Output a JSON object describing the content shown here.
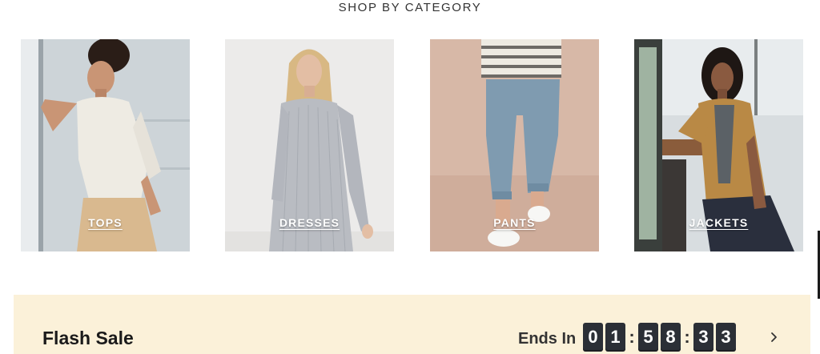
{
  "section": {
    "title": "SHOP BY CATEGORY"
  },
  "categories": [
    {
      "label": "TOPS",
      "image": "woman-in-white-linen-shirt"
    },
    {
      "label": "DRESSES",
      "image": "woman-in-striped-shirt-dress"
    },
    {
      "label": "PANTS",
      "image": "blue-cropped-pants-white-sneakers"
    },
    {
      "label": "JACKETS",
      "image": "woman-in-camel-blazer"
    }
  ],
  "flash_sale": {
    "title": "Flash Sale",
    "ends_in_label": "Ends In",
    "countdown": {
      "d1": "0",
      "d2": "1",
      "d3": "5",
      "d4": "8",
      "d5": "3",
      "d6": "3",
      "sep": ":"
    },
    "chevron_icon": "chevron-right-icon"
  },
  "colors": {
    "banner_bg": "#fbf1d9",
    "digit_bg": "#2b2f36"
  }
}
